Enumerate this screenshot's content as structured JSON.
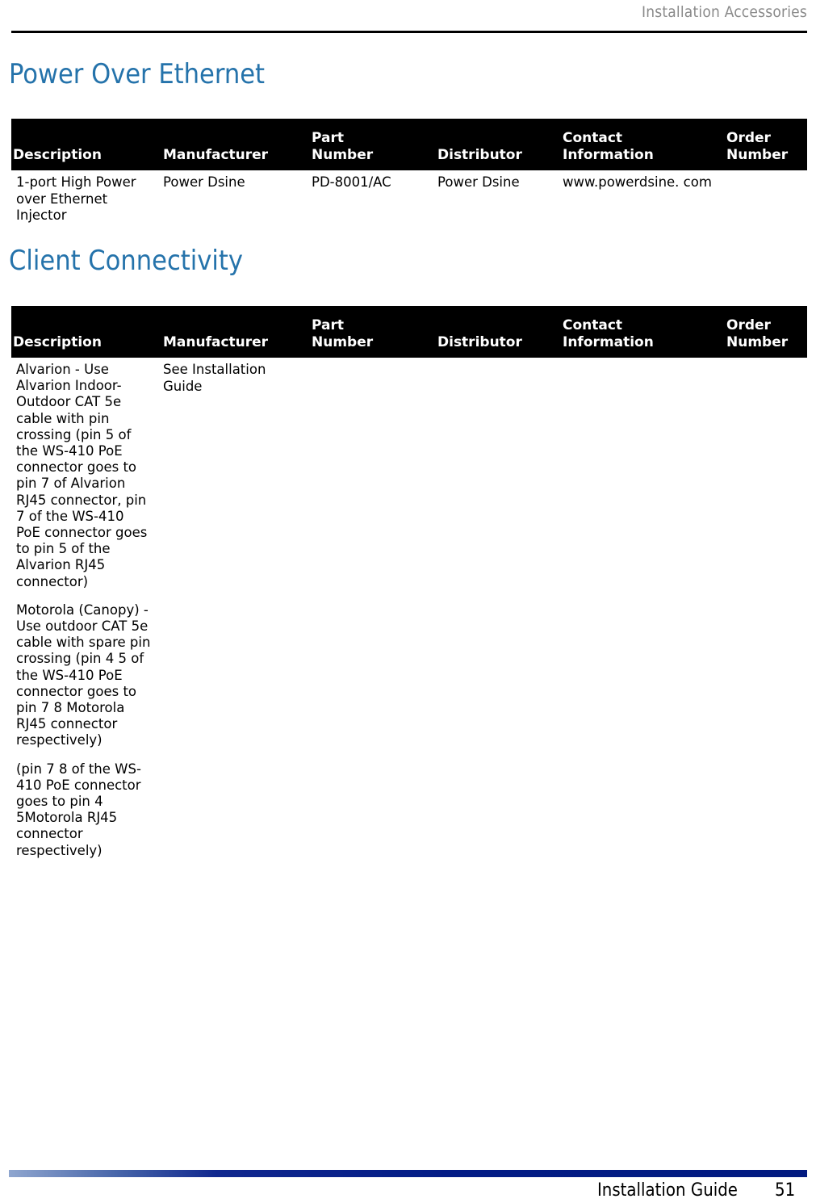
{
  "page": {
    "running_header": "Installation Accessories",
    "footer_label": "Installation Guide",
    "footer_page": "51",
    "accent_heading_color": "#2573ab",
    "footer_bar_gradient_from": "#8fa6cf",
    "footer_bar_gradient_to": "#021a80",
    "table_header_bg": "#000000",
    "table_header_fg": "#ffffff"
  },
  "sections": [
    {
      "heading": "Power Over Ethernet",
      "table": {
        "columns": [
          "Description",
          "Manufacturer",
          "Part\nNumber",
          "Distributor",
          "Contact\nInformation",
          "Order\nNumber"
        ],
        "rows": [
          {
            "description": " 1-port High Power over Ethernet Injector",
            "manufacturer": "Power Dsine",
            "part_number": "PD-8001/AC",
            "distributor": "Power Dsine",
            "contact_information": "www.powerdsine. com",
            "order_number": ""
          }
        ]
      }
    },
    {
      "heading": "Client Connectivity",
      "table": {
        "columns": [
          "Description",
          "Manufacturer",
          "Part\nNumber",
          "Distributor",
          "Contact\nInformation",
          "Order\nNumber"
        ],
        "rows": [
          {
            "description_paragraphs": [
              "Alvarion - Use Alvarion Indoor-Outdoor CAT 5e cable with pin crossing (pin 5 of the WS-410 PoE connector goes to pin 7 of Alvarion RJ45 connector, pin 7 of the WS-410 PoE connector goes to pin 5 of the Alvarion RJ45 connector)",
              "Motorola (Canopy) - Use outdoor CAT 5e cable with spare pin crossing (pin 4 5 of the WS-410 PoE connector goes to pin 7  8 Motorola RJ45 connector respectively)",
              "(pin 7 8 of the WS-410 PoE connector goes to pin 4 5Motorola RJ45 connector respectively)"
            ],
            "manufacturer": "See Installation Guide",
            "part_number": "",
            "distributor": "",
            "contact_information": "",
            "order_number": ""
          }
        ]
      }
    }
  ]
}
